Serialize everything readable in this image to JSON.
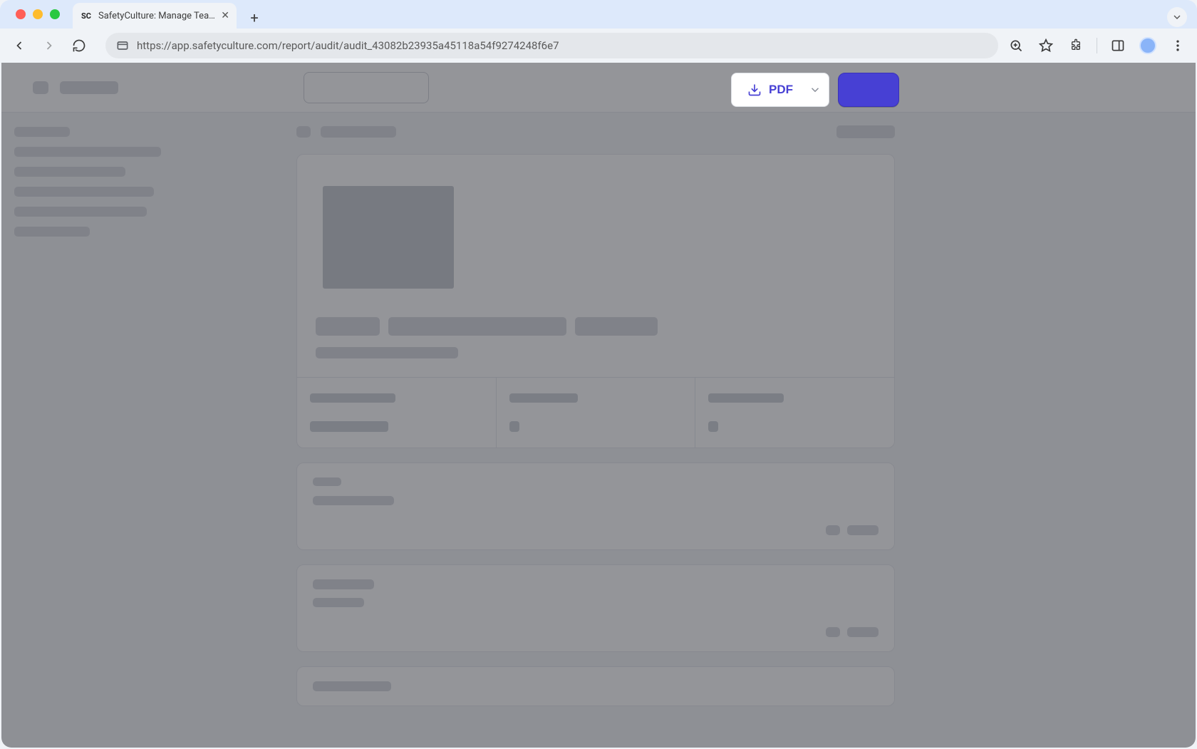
{
  "browser": {
    "tab_title": "SafetyCulture: Manage Teams and...",
    "url": "https://app.safetyculture.com/report/audit/audit_43082b23935a45118a54f9274248f6e7",
    "favicon_text": "SC"
  },
  "actions": {
    "pdf_label": "PDF"
  },
  "colors": {
    "primary": "#4740d4",
    "chrome_bg": "#dde9fb"
  }
}
